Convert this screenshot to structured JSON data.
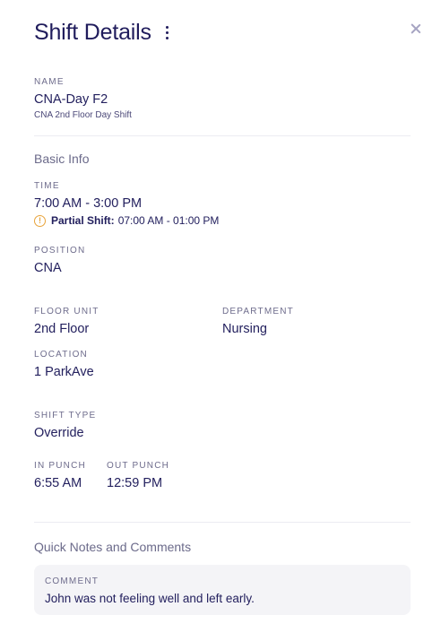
{
  "header": {
    "title": "Shift Details"
  },
  "name": {
    "label": "NAME",
    "value": "CNA-Day F2",
    "description": "CNA 2nd Floor Day Shift"
  },
  "basic_info": {
    "section_title": "Basic Info",
    "time": {
      "label": "TIME",
      "value": "7:00 AM - 3:00 PM"
    },
    "partial_shift": {
      "label": "Partial Shift:",
      "value": "07:00 AM - 01:00 PM",
      "icon": "warning-circle-icon",
      "icon_glyph": "!",
      "icon_color": "#e8a33a"
    },
    "position": {
      "label": "POSITION",
      "value": "CNA"
    },
    "floor_unit": {
      "label": "FLOOR UNIT",
      "value": "2nd Floor"
    },
    "department": {
      "label": "DEPARTMENT",
      "value": "Nursing"
    },
    "location": {
      "label": "LOCATION",
      "value": "1 ParkAve"
    },
    "shift_type": {
      "label": "SHIFT TYPE",
      "value": "Override"
    },
    "in_punch": {
      "label": "IN PUNCH",
      "value": "6:55 AM"
    },
    "out_punch": {
      "label": "OUT PUNCH",
      "value": "12:59 PM"
    }
  },
  "notes": {
    "section_title": "Quick Notes and Comments",
    "comment": {
      "label": "COMMENT",
      "text": "John was not feeling well and left early."
    }
  },
  "colors": {
    "title": "#201c5c",
    "label": "#6e6c8c",
    "value": "#23205e",
    "warning": "#e8a33a",
    "comment_bg": "#f4f4f7"
  }
}
